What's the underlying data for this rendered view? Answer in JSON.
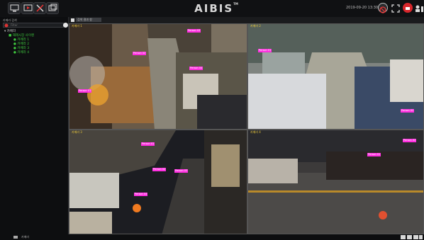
{
  "app": {
    "logo": "AIBIS",
    "logo_mark": "TM",
    "datetime": "2019-09-20 13:30:31"
  },
  "left_panel": {
    "title": "카메라 검색",
    "search_placeholder": "Filter",
    "tree": {
      "root": "카메라",
      "group": "재래시장 사이렌",
      "cameras": [
        "카메라 1",
        "카메라 2",
        "카메라 3",
        "카메라 4"
      ]
    }
  },
  "tabbar": {
    "tab_label": "검색 결과 창"
  },
  "tiles": [
    {
      "title": "카메라 1",
      "tags": [
        "Person 01",
        "Person 02",
        "Person 03",
        "Person 04"
      ]
    },
    {
      "title": "카메라 2",
      "tags": [
        "Person 01",
        "Person 02"
      ]
    },
    {
      "title": "카메라 3",
      "tags": [
        "Person 01",
        "Person 02",
        "Person 03",
        "Person 04"
      ]
    },
    {
      "title": "카메라 4",
      "tags": [
        "Person 01",
        "Person 02"
      ]
    }
  ],
  "status": {
    "label": "카메라"
  },
  "colors": {
    "tag": "#ff2ee0",
    "tree_green": "#3ec93e",
    "tile_title": "#e7c53a"
  }
}
